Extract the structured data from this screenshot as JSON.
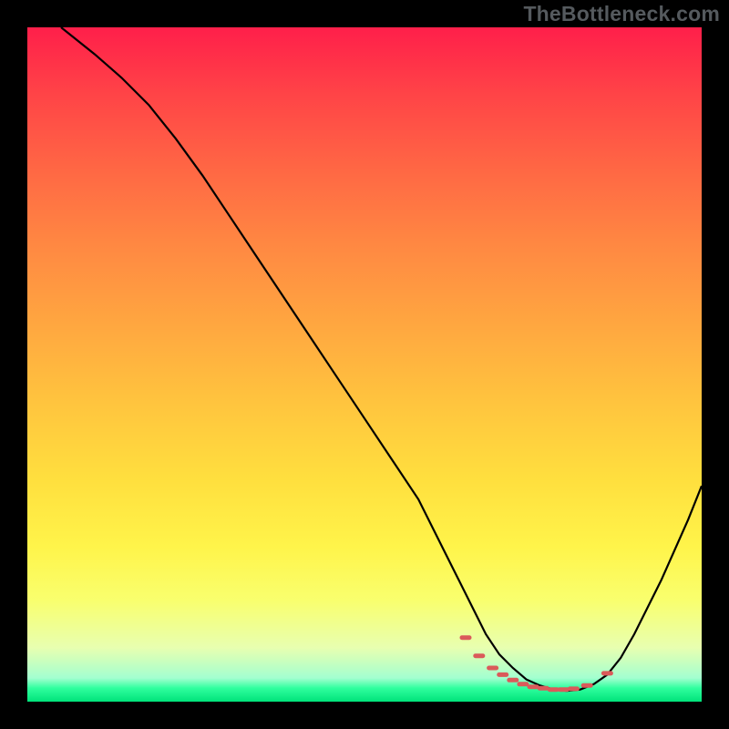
{
  "watermark": "TheBottleneck.com",
  "chart_data": {
    "type": "line",
    "title": "",
    "xlabel": "",
    "ylabel": "",
    "xlim": [
      0,
      100
    ],
    "ylim": [
      0,
      100
    ],
    "note": "Axes are hidden; values below are estimated from pixel positions (0–100 scale).",
    "series": [
      {
        "name": "bottleneck-curve",
        "x": [
          5,
          10,
          14,
          18,
          22,
          26,
          30,
          34,
          38,
          42,
          46,
          50,
          54,
          58,
          62,
          64,
          66,
          68,
          70,
          72,
          74,
          76,
          78,
          80,
          82,
          84,
          86,
          88,
          90,
          94,
          98,
          100
        ],
        "y": [
          100,
          96,
          92.5,
          88.5,
          83.5,
          78,
          72,
          66,
          60,
          54,
          48,
          42,
          36,
          30,
          22,
          18,
          14,
          10,
          7,
          5,
          3.3,
          2.4,
          1.8,
          1.6,
          1.8,
          2.6,
          4,
          6.5,
          10,
          18,
          27,
          32
        ]
      }
    ],
    "markers": {
      "name": "valley-dashes",
      "style": "short-dash",
      "color": "#da5a5a",
      "x": [
        65,
        67,
        69,
        70.5,
        72,
        73.5,
        75,
        76.5,
        78,
        79.5,
        81,
        83,
        86
      ],
      "y": [
        9.5,
        6.8,
        5.0,
        4.0,
        3.2,
        2.6,
        2.2,
        2.0,
        1.8,
        1.8,
        1.9,
        2.4,
        4.2
      ]
    },
    "gradient": {
      "description": "Vertical gradient from red (top, high bottleneck) to green (bottom, low bottleneck)",
      "stops": [
        {
          "pct": 0,
          "color": "#ff1f4a"
        },
        {
          "pct": 22,
          "color": "#ff6a44"
        },
        {
          "pct": 45,
          "color": "#ffa940"
        },
        {
          "pct": 67,
          "color": "#ffdf3e"
        },
        {
          "pct": 85,
          "color": "#f9ff6e"
        },
        {
          "pct": 96,
          "color": "#a3ffd0"
        },
        {
          "pct": 100,
          "color": "#00e27a"
        }
      ]
    }
  }
}
